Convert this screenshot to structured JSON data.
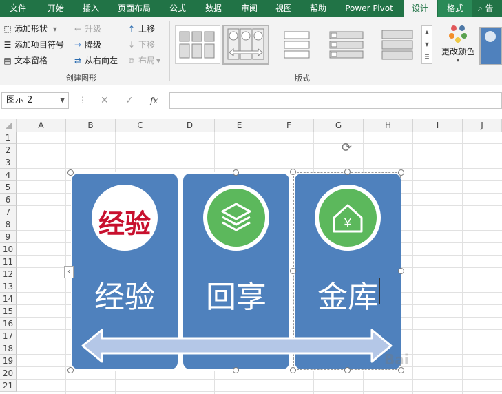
{
  "tabs": [
    "文件",
    "开始",
    "插入",
    "页面布局",
    "公式",
    "数据",
    "审阅",
    "视图",
    "帮助",
    "Power Pivot",
    "设计",
    "格式",
    "告"
  ],
  "ribbon": {
    "create": {
      "add_shape": "添加形状",
      "add_bullet": "添加项目符号",
      "text_pane": "文本窗格",
      "promote": "升级",
      "demote": "降级",
      "rtl": "从右向左",
      "move_up": "上移",
      "move_down": "下移",
      "layout": "布局",
      "group_label": "创建图形"
    },
    "layouts_label": "版式",
    "change_colors": "更改颜色"
  },
  "formula_bar": {
    "name_box": "图示 2",
    "fx": "fx",
    "cancel": "✕",
    "enter": "✓"
  },
  "columns": [
    "A",
    "B",
    "C",
    "D",
    "E",
    "F",
    "G",
    "H",
    "I",
    "J"
  ],
  "rows": [
    "1",
    "2",
    "3",
    "4",
    "5",
    "6",
    "7",
    "8",
    "9",
    "10",
    "11",
    "12",
    "13",
    "14",
    "15",
    "16",
    "17",
    "18",
    "19",
    "20",
    "21"
  ],
  "smartart": {
    "items": [
      "经验",
      "回享",
      "金库"
    ],
    "logo_text": "经验",
    "watermark": "Bai"
  },
  "colors": {
    "excel_green": "#217346",
    "card_blue": "#4f81bd",
    "icon_green": "#5cb85c",
    "logo_red": "#c8102e"
  }
}
